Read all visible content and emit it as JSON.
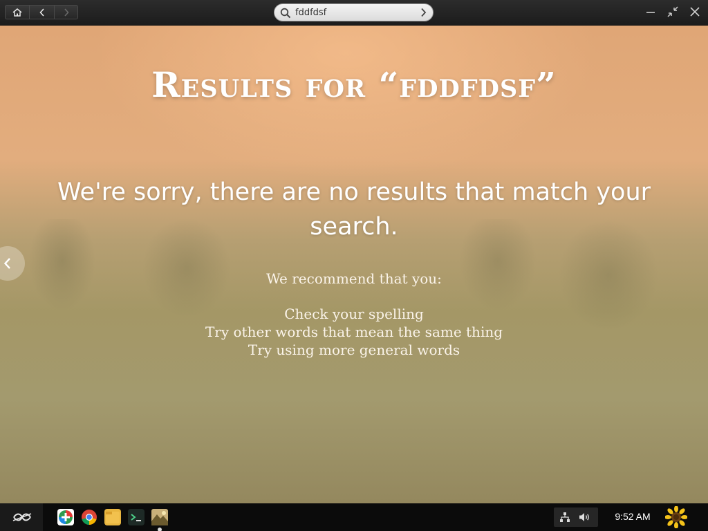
{
  "toolbar": {
    "home_icon": "home-icon",
    "back_icon": "chevron-left-icon",
    "forward_icon": "chevron-right-icon"
  },
  "search": {
    "value": "fddfdsf",
    "icon": "search-icon",
    "go_icon": "chevron-right-icon"
  },
  "window_controls": [
    "minimize-icon",
    "unmaximize-icon",
    "close-icon"
  ],
  "main": {
    "title": "Results for “fddfdsf”",
    "message": "We're sorry, there are no results that match your search.",
    "recommend_heading": "We recommend that you:",
    "tips": [
      "Check your spelling",
      "Try other words that mean the same thing",
      "Try using more general words"
    ]
  },
  "taskbar": {
    "apps": [
      "app-store-icon",
      "chrome-icon",
      "files-icon",
      "terminal-icon",
      "encyclopedia-icon"
    ],
    "clock": "9:52 AM",
    "tray": [
      "network-icon",
      "volume-icon"
    ]
  }
}
